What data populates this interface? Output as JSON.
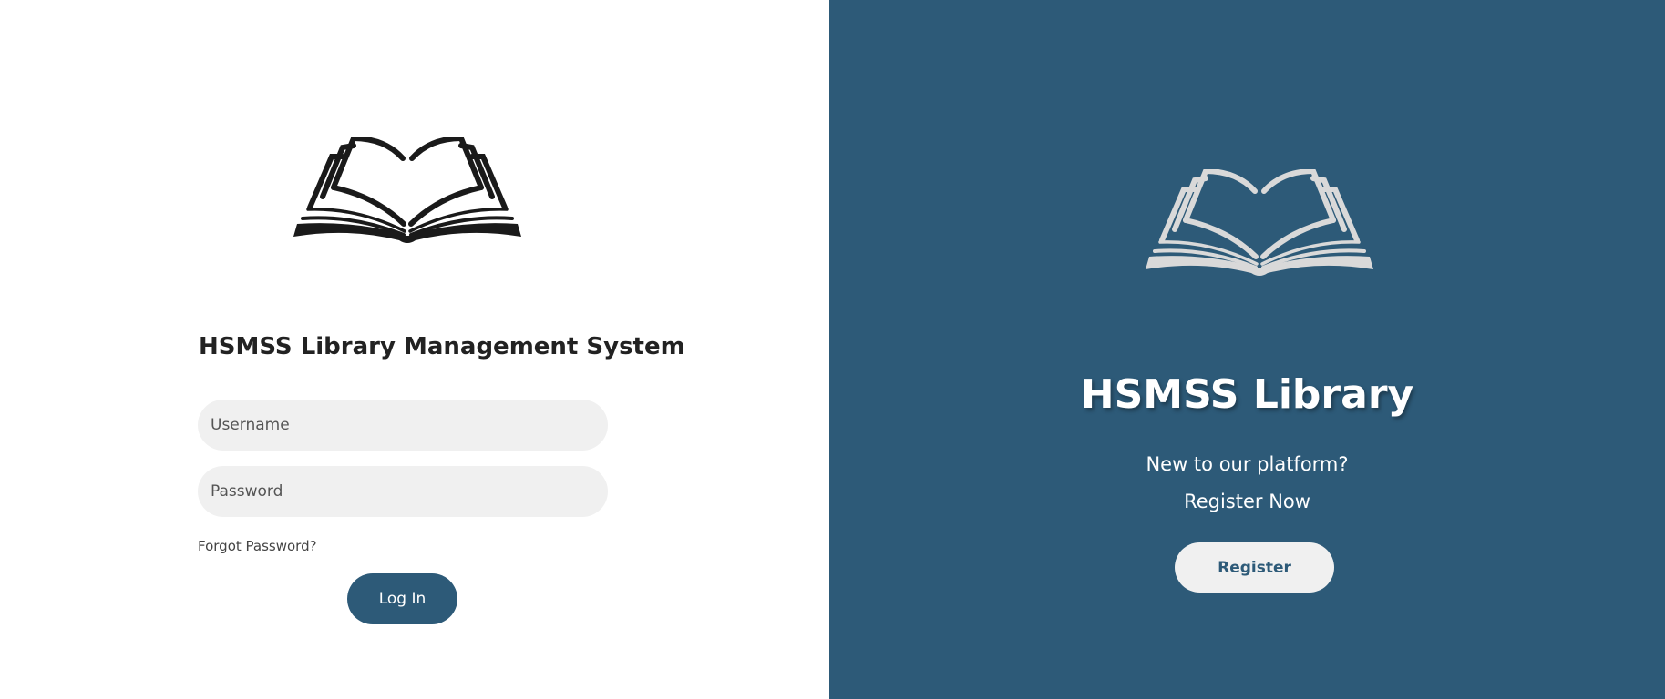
{
  "login": {
    "title": "HSMSS Library Management System",
    "username_placeholder": "Username",
    "password_placeholder": "Password",
    "forgot_password": "Forgot Password?",
    "login_label": "Log In",
    "logo_icon": "open-book-icon",
    "logo_color": "#1a1a1a"
  },
  "signup": {
    "title": "HSMSS Library",
    "prompt": "New to our platform?",
    "cta": "Register Now",
    "register_label": "Register",
    "logo_icon": "open-book-icon",
    "logo_color": "#d9d9d9"
  },
  "colors": {
    "accent": "#2d5a78",
    "input_bg": "#f0f0f0"
  }
}
